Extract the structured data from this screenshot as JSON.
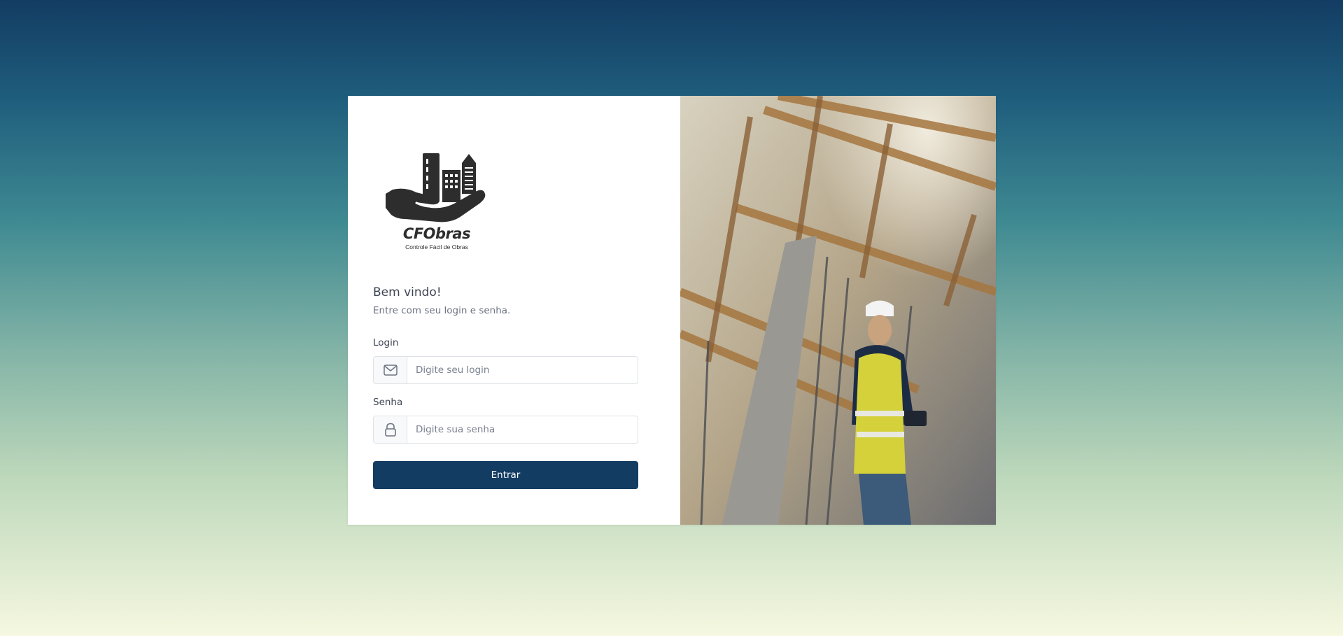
{
  "brand": {
    "name": "CFObras",
    "tagline": "Controle Fácil de Obras"
  },
  "login_form": {
    "heading": "Bem vindo!",
    "subheading": "Entre com seu login e senha.",
    "login": {
      "label": "Login",
      "placeholder": "Digite seu login",
      "value": "",
      "icon": "envelope-icon"
    },
    "password": {
      "label": "Senha",
      "placeholder": "Digite sua senha",
      "value": "",
      "icon": "lock-icon"
    },
    "submit_label": "Entrar"
  },
  "colors": {
    "primary": "#133c63",
    "background_top": "#133c63",
    "background_bottom": "#f6f8e0"
  }
}
